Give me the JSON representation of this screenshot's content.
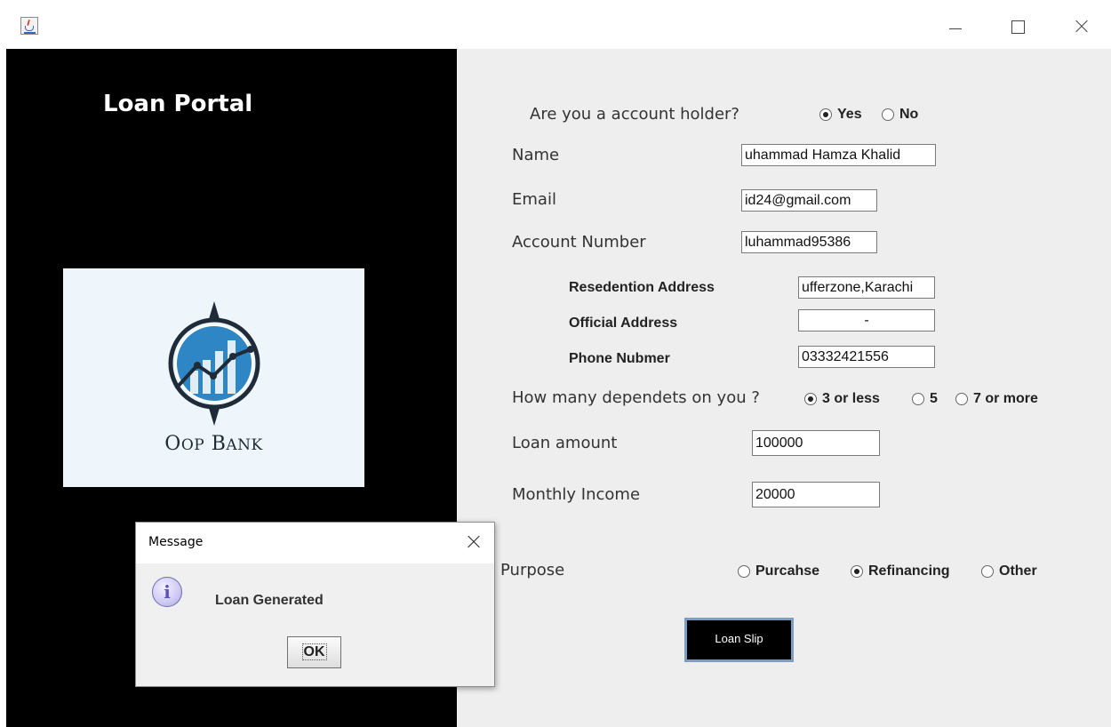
{
  "window": {
    "app_icon": "java-cup-icon",
    "controls": {
      "minimize": "minimize-icon",
      "maximize": "maximize-icon",
      "close": "close-icon"
    }
  },
  "left_panel": {
    "title": "Loan Portal",
    "logo": {
      "text_first": "O",
      "text_first_sc": "OP",
      "text_second": "B",
      "text_second_sc": "ANK",
      "icon": "compass-chart-logo"
    }
  },
  "form": {
    "account_holder": {
      "question": "Are you a account holder?",
      "options": [
        "Yes",
        "No"
      ],
      "selected": "Yes"
    },
    "name": {
      "label": "Name",
      "value": "uhammad Hamza Khalid"
    },
    "email": {
      "label": "Email",
      "value": "id24@gmail.com"
    },
    "account_number": {
      "label": "Account Number",
      "value": "luhammad95386"
    },
    "residential_address": {
      "label": "Resedention Address",
      "value": "ufferzone,Karachi"
    },
    "official_address": {
      "label": "Official Address",
      "value": "-"
    },
    "phone": {
      "label": "Phone Nubmer",
      "value": "03332421556"
    },
    "dependents": {
      "question": "How many dependets on you ?",
      "options": [
        "3 or less",
        "5",
        "7 or more"
      ],
      "selected": "3 or less"
    },
    "loan_amount": {
      "label": "Loan amount",
      "value": "100000"
    },
    "monthly_income": {
      "label": "Monthly Income",
      "value": "20000"
    },
    "purpose": {
      "label": "Purpose",
      "options": [
        "Purcahse",
        "Refinancing",
        "Other"
      ],
      "selected": "Refinancing"
    },
    "loan_slip_button": "Loan Slip"
  },
  "dialog": {
    "title": "Message",
    "icon": "info-icon",
    "message": "Loan Generated",
    "ok_label": "OK"
  },
  "colors": {
    "left_panel_bg": "#000000",
    "form_bg": "#eeeeee",
    "logo_blue": "#2f86c4",
    "button_border": "#7d9ec0"
  }
}
